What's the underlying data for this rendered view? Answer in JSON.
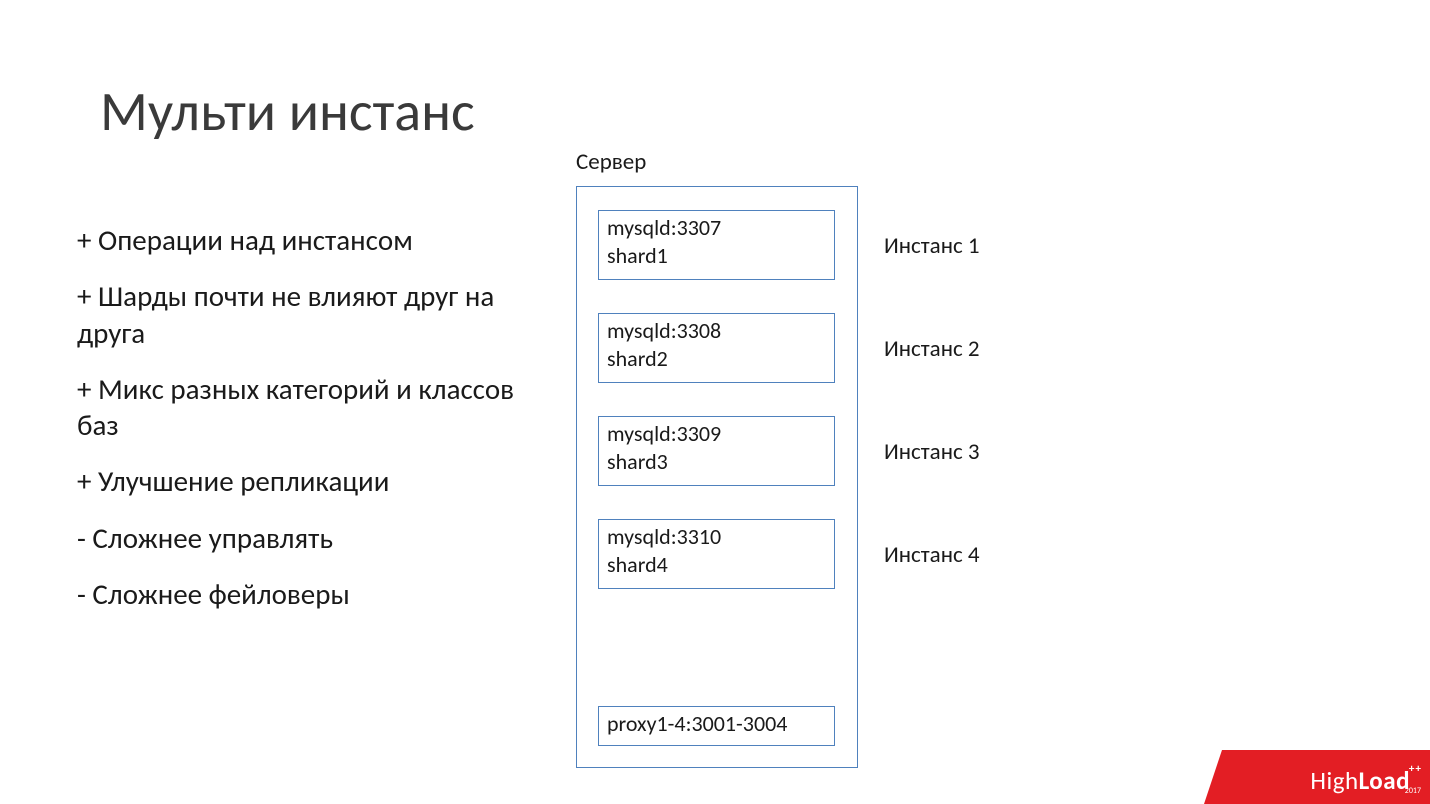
{
  "title": "Мульти инстанс",
  "bullets": [
    "+ Операции над инстансом",
    "+ Шарды почти не влияют друг на друга",
    "+ Микс разных категорий и классов баз",
    "+ Улучшение репликации",
    "",
    "- Сложнее управлять",
    "- Сложнее фейловеры"
  ],
  "server_label": "Сервер",
  "instances": [
    {
      "box_l1": "mysqld:3307",
      "box_l2": "shard1",
      "side": "Инстанс 1"
    },
    {
      "box_l1": "mysqld:3308",
      "box_l2": "shard2",
      "side": "Инстанс 2"
    },
    {
      "box_l1": "mysqld:3309",
      "box_l2": "shard3",
      "side": "Инстанс 3"
    },
    {
      "box_l1": "mysqld:3310",
      "box_l2": "shard4",
      "side": "Инстанс 4"
    }
  ],
  "proxy": {
    "box_l1": "proxy1-4:3001-3004"
  },
  "logo": {
    "high": "High",
    "load": "Load",
    "plus": "++",
    "year": "2017"
  },
  "colors": {
    "accent_border": "#4f81bd",
    "logo_bg": "#e31e24"
  }
}
